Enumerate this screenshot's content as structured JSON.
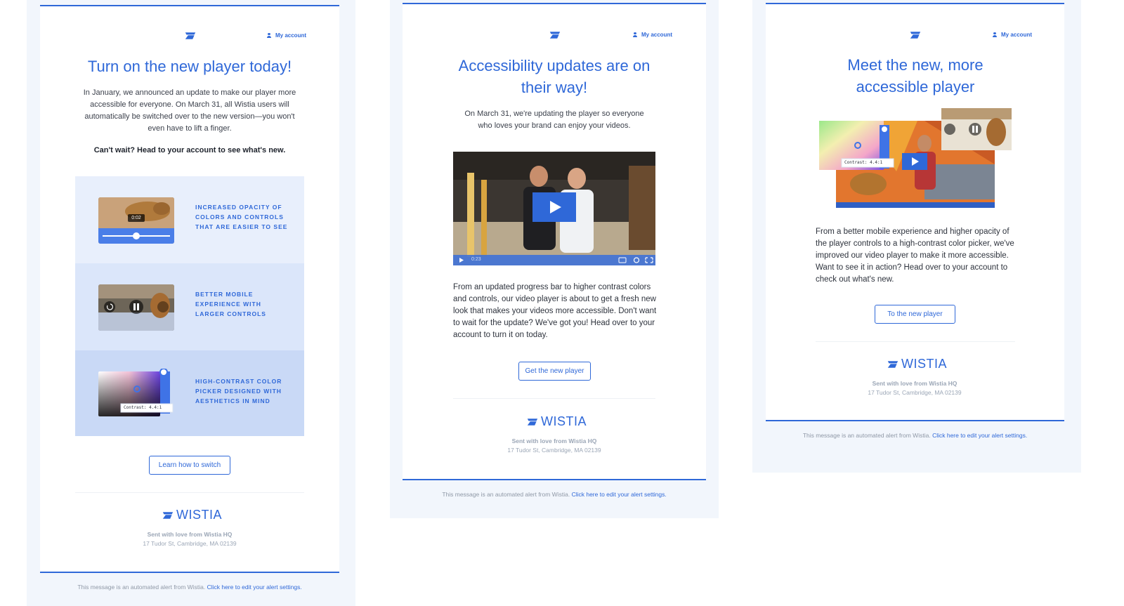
{
  "colors": {
    "accent": "#2f68d8",
    "panel": "#f2f6fc",
    "feature_1": "#e8effc",
    "feature_2": "#dbe6fa",
    "feature_3": "#c9d9f6"
  },
  "icons": [
    "wistia-mark-icon",
    "person-icon",
    "play-icon",
    "pause-icon",
    "rewind-icon",
    "forward-icon",
    "fullscreen-icon",
    "settings-icon",
    "captions-icon"
  ],
  "email1": {
    "account_label": "My account",
    "title": "Turn on the new player today!",
    "intro": "In January, we announced an update to make our player more accessible for everyone. On March 31, all Wistia users will automatically be switched over to the new version—you won't even have to lift a finger.",
    "cta_text": "Can't wait? Head to your account to see what's new.",
    "features": [
      {
        "label": "Increased opacity of colors and controls that are easier to see",
        "time": "0:02"
      },
      {
        "label": "Better mobile experience with larger controls"
      },
      {
        "label": "High-contrast color picker designed with aesthetics in mind",
        "contrast": "Contrast: 4.4:1"
      }
    ],
    "button": "Learn how to switch",
    "brand": "WISTIA",
    "footer_sent": "Sent with love from Wistia HQ",
    "footer_address": "17 Tudor St, Cambridge, MA 02139",
    "alert_text": "This message is an automated alert from Wistia.",
    "alert_link": "Click here to edit your alert settings."
  },
  "email2": {
    "account_label": "My account",
    "title": "Accessibility updates are on their way!",
    "intro": "On March 31, we're updating the player so everyone who loves your brand can enjoy your videos.",
    "body": "From an updated progress bar to higher contrast colors and controls, our video player is about to get a fresh new look that makes your videos more accessible. Don't want to wait for the update? We've got you! Head over to your account to turn it on today.",
    "video_time": "0:23",
    "button": "Get the new player",
    "brand": "WISTIA",
    "footer_sent": "Sent with love from Wistia HQ",
    "footer_address": "17 Tudor St, Cambridge, MA 02139",
    "alert_text": "This message is an automated alert from Wistia.",
    "alert_link": "Click here to edit your alert settings."
  },
  "email3": {
    "account_label": "My account",
    "title": "Meet the new, more accessible player",
    "contrast": "Contrast: 4.4:1",
    "body": "From a better mobile experience and higher opacity of the player controls to a high-contrast color picker, we've improved our video player to make it more accessible. Want to see it in action? Head over to your account to check out what's new.",
    "button": "To the new player",
    "brand": "WISTIA",
    "footer_sent": "Sent with love from Wistia HQ",
    "footer_address": "17 Tudor St, Cambridge, MA 02139",
    "alert_text": "This message is an automated alert from Wistia.",
    "alert_link": "Click here to edit your alert settings."
  }
}
